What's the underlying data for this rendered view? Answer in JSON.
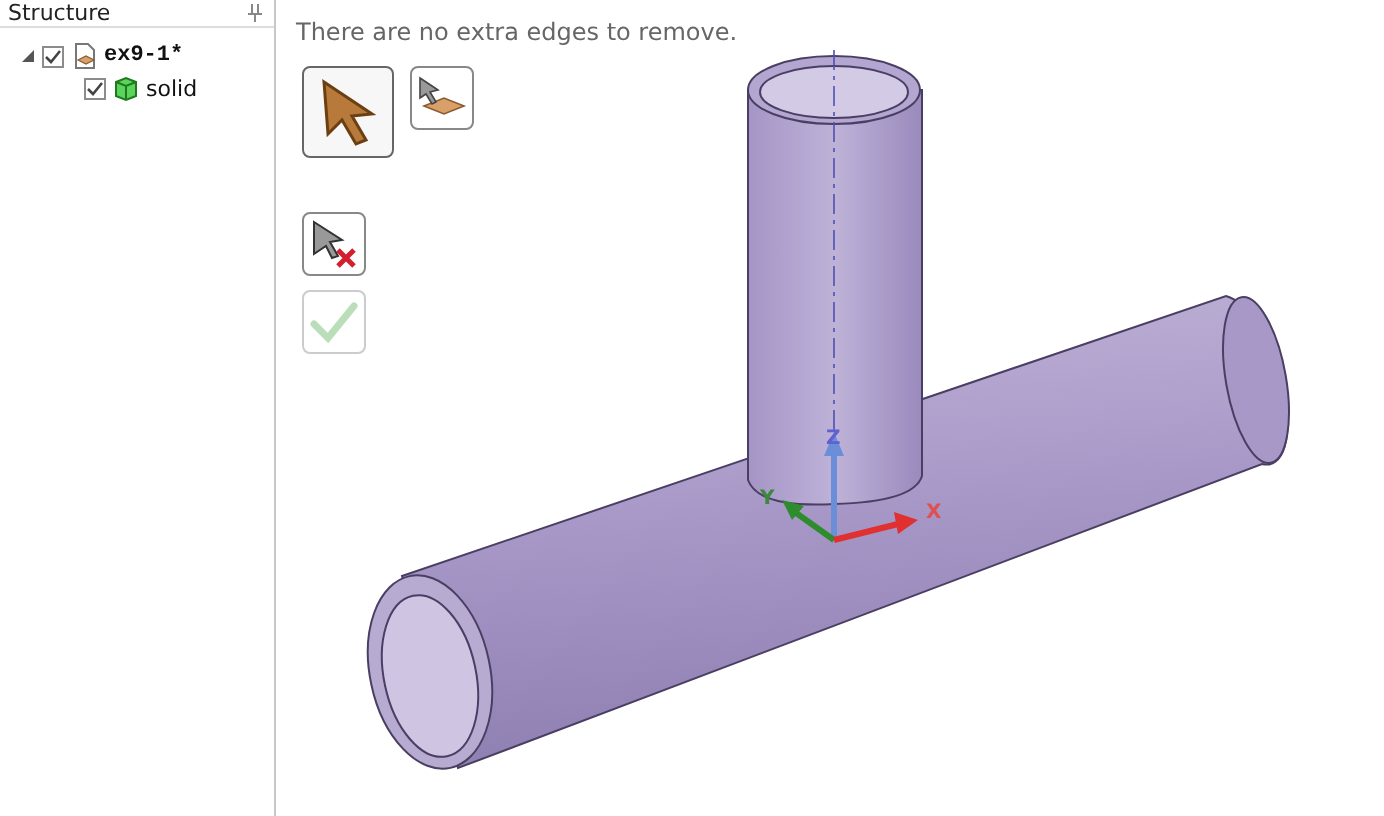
{
  "panel": {
    "title": "Structure",
    "tree": [
      {
        "label": "ex9-1*",
        "kind": "document",
        "expanded": true,
        "checked": true,
        "children": [
          {
            "label": "solid",
            "kind": "body",
            "checked": true
          }
        ]
      }
    ]
  },
  "viewport": {
    "message": "There are no extra edges to remove.",
    "tools": [
      {
        "kind": "select",
        "selected": true,
        "disabled": false
      },
      {
        "kind": "select-face",
        "selected": false,
        "disabled": false
      },
      {
        "kind": "deselect",
        "selected": false,
        "disabled": false
      },
      {
        "kind": "confirm",
        "selected": false,
        "disabled": true
      }
    ],
    "axes": [
      "Z",
      "Y",
      "X"
    ]
  }
}
